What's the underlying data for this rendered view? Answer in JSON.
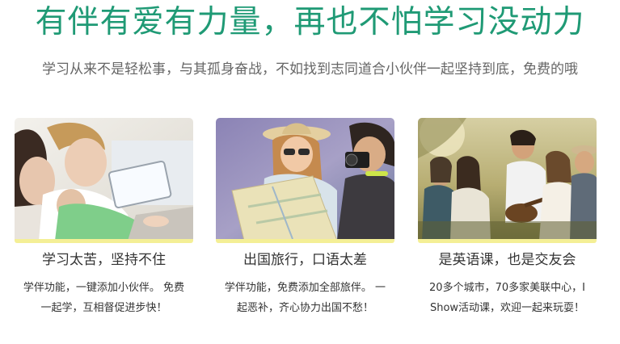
{
  "header": {
    "title": "有伴有爱有力量，再也不怕学习没动力",
    "subtitle": "学习从来不是轻松事，与其孤身奋战，不如找到志同道合小伙伴一起坚持到底，免费的哦"
  },
  "cards": [
    {
      "title": "学习太苦，坚持不住",
      "desc_lines": [
        "学伴功能，一键添加小伙伴。 免费",
        "一起学，互相督促进步快！"
      ],
      "photo_icon": "students-studying-photo"
    },
    {
      "title": "出国旅行，口语太差",
      "desc_lines": [
        "学伴功能，免费添加全部旅伴。 一",
        "起恶补，齐心协力出国不愁！"
      ],
      "photo_icon": "travelers-map-photo"
    },
    {
      "title": "是英语课，也是交友会",
      "desc_lines": [
        "20多个城市，70多家美联中心，I",
        "Show活动课，欢迎一起来玩耍！"
      ],
      "photo_icon": "friends-park-photo"
    }
  ],
  "colors": {
    "headline": "#1f9a75",
    "subtitle": "#666666",
    "accent_bar": "#f4ef96",
    "text": "#333333"
  }
}
